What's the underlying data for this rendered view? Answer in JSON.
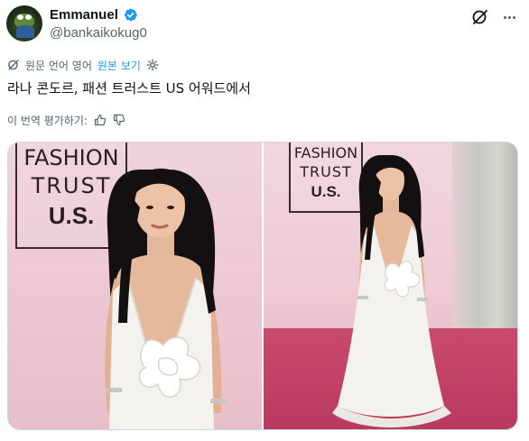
{
  "tweet": {
    "author": {
      "display_name": "Emmanuel",
      "handle": "@bankaikokug0",
      "avatar_icon": "pepe-frog-avatar",
      "verified_icon": "verified-badge-icon",
      "verified_color": "#1d9bf0"
    },
    "actions": {
      "grok_icon": "grok-icon",
      "more_icon": "more-options-icon"
    },
    "translation": {
      "label": "원문 언어 영어",
      "show_original": "원본 보기",
      "link_color": "#1d9bf0"
    },
    "text": "라나 콘도르, 패션 트러스트 US 어워드에서",
    "rate_translation": {
      "label": "이 번역 평가하기:",
      "like_icon": "thumbs-up-icon",
      "dislike_icon": "thumbs-down-icon"
    },
    "media": {
      "photos": [
        {
          "sign_line1": "FASHION",
          "sign_line2": "TRUST",
          "sign_line3": "U.S."
        },
        {
          "sign_line1": "FASHION",
          "sign_line2": "TRUST",
          "sign_line3": "U.S."
        }
      ]
    }
  }
}
